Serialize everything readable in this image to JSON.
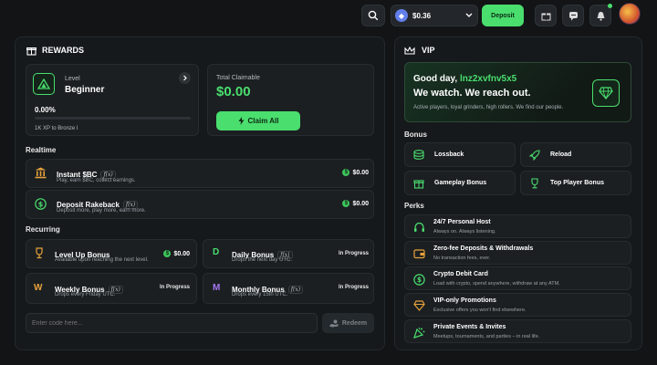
{
  "topbar": {
    "balance": "$0.36",
    "deposit_label": "Deposit"
  },
  "rewards": {
    "title": "REWARDS",
    "level_label": "Level",
    "level_value": "Beginner",
    "progress_pct": "0.00%",
    "progress_fraction": 0,
    "xp_text": "1K XP to Bronze I",
    "claimable_label": "Total Claimable",
    "claimable_value": "$0.00",
    "claim_all_label": "Claim All",
    "realtime_label": "Realtime",
    "realtime": [
      {
        "name": "Instant $BC",
        "fx": "f(x)",
        "desc": "Play, earn $BC, collect earnings.",
        "value": "$0.00",
        "icon": "bank-icon"
      },
      {
        "name": "Deposit Rakeback",
        "fx": "f(x)",
        "desc": "Deposit more, play more, earn more.",
        "value": "$0.00",
        "icon": "dollar-coin-icon"
      }
    ],
    "recurring_label": "Recurring",
    "recurring": [
      {
        "name": "Level Up Bonus",
        "fx": "",
        "desc": "Available upon reaching the next level.",
        "value": "$0.00",
        "icon": "trophy-icon",
        "letter": ""
      },
      {
        "name": "Daily Bonus",
        "fx": "f(x)",
        "desc": "Drops the next day UTC.",
        "value": "In Progress",
        "icon": "letter-d-icon",
        "letter": "D"
      },
      {
        "name": "Weekly Bonus",
        "fx": "f(x)",
        "desc": "Drops every Friday UTC.",
        "value": "In Progress",
        "icon": "letter-w-icon",
        "letter": "W"
      },
      {
        "name": "Monthly Bonus",
        "fx": "f(x)",
        "desc": "Drops every 15th UTC.",
        "value": "In Progress",
        "icon": "letter-m-icon",
        "letter": "M"
      }
    ],
    "code_placeholder": "Enter code here...",
    "redeem_label": "Redeem"
  },
  "vip": {
    "title": "VIP",
    "greeting_prefix": "Good day, ",
    "username": "lnz2xvfnv5x5",
    "headline": "We watch. We reach out.",
    "subtext": "Active players, loyal grinders, high rollers. We find our people.",
    "bonus_label": "Bonus",
    "bonuses": [
      {
        "label": "Lossback",
        "icon": "coin-stack-icon"
      },
      {
        "label": "Reload",
        "icon": "rocket-icon"
      },
      {
        "label": "Gameplay Bonus",
        "icon": "gift-icon"
      },
      {
        "label": "Top Player Bonus",
        "icon": "trophy-icon"
      }
    ],
    "perks_label": "Perks",
    "perks": [
      {
        "title": "24/7 Personal Host",
        "desc": "Always on. Always listening.",
        "icon": "headset-icon"
      },
      {
        "title": "Zero-fee Deposits & Withdrawals",
        "desc": "No transaction fees, ever.",
        "icon": "wallet-icon"
      },
      {
        "title": "Crypto Debit Card",
        "desc": "Load with crypto, spend anywhere, withdraw at any ATM.",
        "icon": "card-coin-icon"
      },
      {
        "title": "VIP-only Promotions",
        "desc": "Exclusive offers you won't find elsewhere.",
        "icon": "diamond-icon"
      },
      {
        "title": "Private Events & Invites",
        "desc": "Meetups, tournaments, and parties – in real life.",
        "icon": "party-icon"
      }
    ]
  },
  "colors": {
    "accent": "#4ade6e",
    "background": "#121416",
    "panel": "#16191c",
    "card": "#1b1f22"
  }
}
